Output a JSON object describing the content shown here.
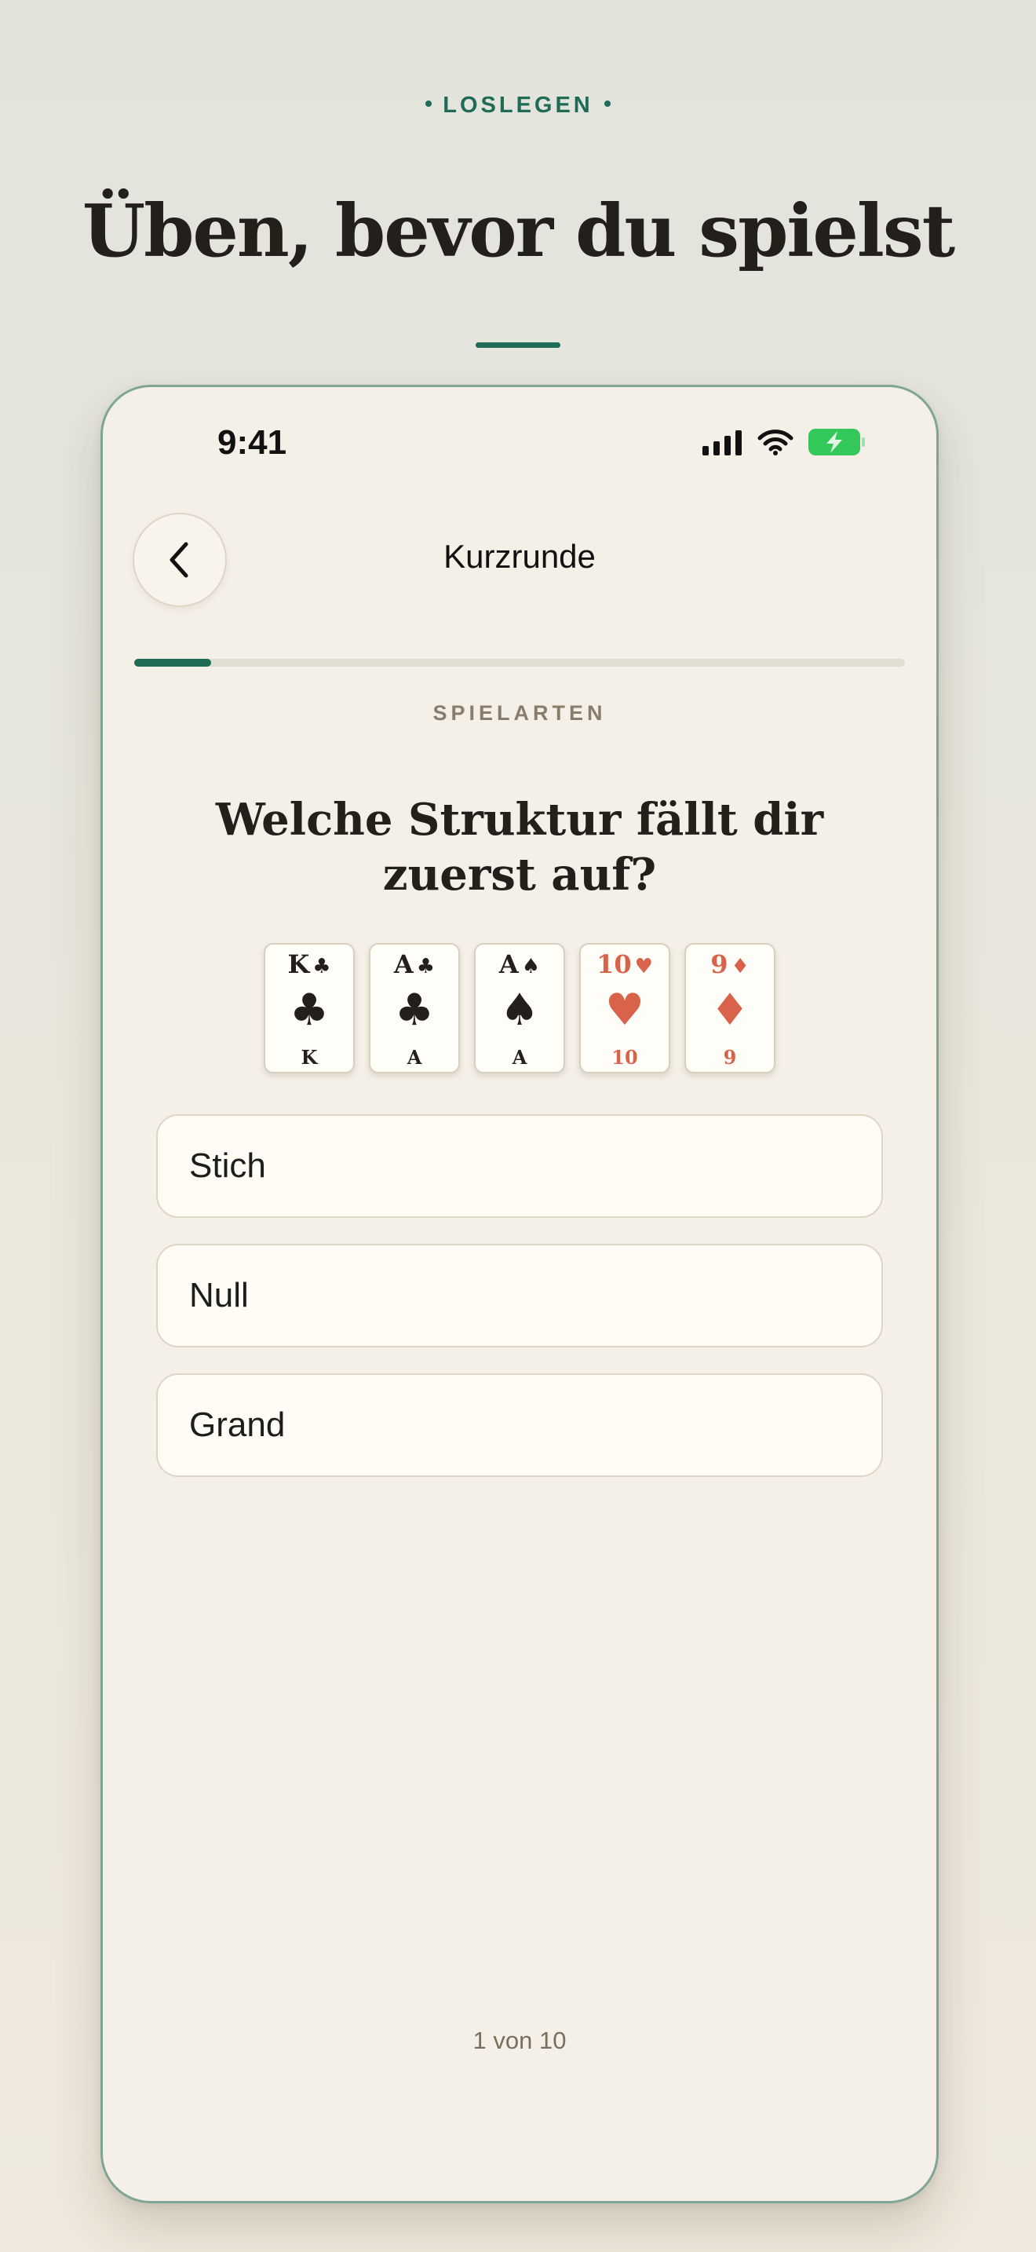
{
  "header": {
    "eyebrow": "LOSLEGEN",
    "headline": "Üben, bevor du spielst"
  },
  "status_bar": {
    "time": "9:41"
  },
  "nav": {
    "title": "Kurzrunde"
  },
  "progress": {
    "fraction": 0.1
  },
  "quiz": {
    "category": "SPIELARTEN",
    "question": "Welche Struktur fällt dir zuerst auf?",
    "cards": [
      {
        "rank": "K",
        "suit": "♣",
        "color": "black"
      },
      {
        "rank": "A",
        "suit": "♣",
        "color": "black"
      },
      {
        "rank": "A",
        "suit": "♠",
        "color": "black"
      },
      {
        "rank": "10",
        "suit": "♥",
        "color": "red"
      },
      {
        "rank": "9",
        "suit": "♦",
        "color": "red"
      }
    ],
    "options": [
      "Stich",
      "Null",
      "Grand"
    ],
    "counter": "1 von 10"
  },
  "colors": {
    "accent": "#1f6b57",
    "card_red": "#d8634a",
    "card_black": "#231f1a",
    "battery": "#34c759"
  },
  "icons": {
    "back": "chevron-left-icon",
    "signal": "cellular-signal-icon",
    "wifi": "wifi-icon",
    "battery": "battery-charging-icon"
  }
}
